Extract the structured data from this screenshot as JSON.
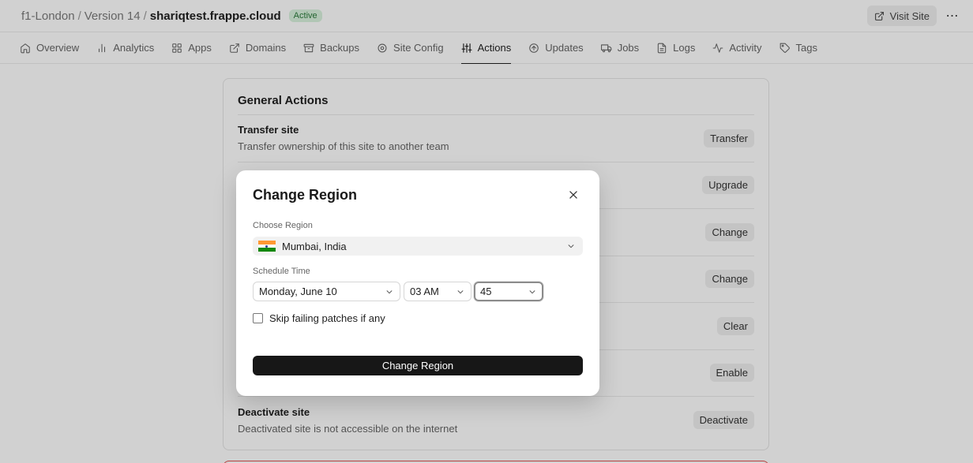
{
  "header": {
    "breadcrumb": [
      "f1-London",
      "Version 14",
      "shariqtest.frappe.cloud"
    ],
    "status_badge": "Active",
    "visit_site": "Visit Site",
    "more": "⋯"
  },
  "tabs": [
    {
      "label": "Overview",
      "icon": "home-icon"
    },
    {
      "label": "Analytics",
      "icon": "bar-chart-icon"
    },
    {
      "label": "Apps",
      "icon": "grid-icon"
    },
    {
      "label": "Domains",
      "icon": "external-link-icon"
    },
    {
      "label": "Backups",
      "icon": "archive-icon"
    },
    {
      "label": "Site Config",
      "icon": "settings-icon"
    },
    {
      "label": "Actions",
      "icon": "sliders-icon",
      "active": true
    },
    {
      "label": "Updates",
      "icon": "arrow-up-circle-icon"
    },
    {
      "label": "Jobs",
      "icon": "truck-icon"
    },
    {
      "label": "Logs",
      "icon": "file-text-icon"
    },
    {
      "label": "Activity",
      "icon": "activity-icon"
    },
    {
      "label": "Tags",
      "icon": "tag-icon"
    }
  ],
  "general_actions": {
    "title": "General Actions",
    "rows": [
      {
        "title": "Transfer site",
        "description": "Transfer ownership of this site to another team",
        "button": "Transfer"
      },
      {
        "title": "",
        "description": "",
        "button": "Upgrade"
      },
      {
        "title": "",
        "description": "",
        "button": "Change"
      },
      {
        "title": "",
        "description": "",
        "button": "Change"
      },
      {
        "title": "",
        "description": "",
        "button": "Clear"
      },
      {
        "title": "",
        "description": "",
        "button": "Enable"
      },
      {
        "title": "Deactivate site",
        "description": "Deactivated site is not accessible on the internet",
        "button": "Deactivate"
      }
    ]
  },
  "modal": {
    "title": "Change Region",
    "region_label": "Choose Region",
    "region_value": "Mumbai, India",
    "schedule_label": "Schedule Time",
    "date_value": "Monday, June 10",
    "hour_value": "03 AM",
    "minute_value": "45",
    "skip_label": "Skip failing patches if any",
    "submit": "Change Region"
  },
  "colors": {
    "active_badge_bg": "#d8f2dd",
    "active_badge_text": "#2b7a3b",
    "primary_button": "#171717",
    "danger_border": "#e24c4c",
    "flag_saffron": "#ff9933",
    "flag_white": "#ffffff",
    "flag_green": "#138808"
  }
}
